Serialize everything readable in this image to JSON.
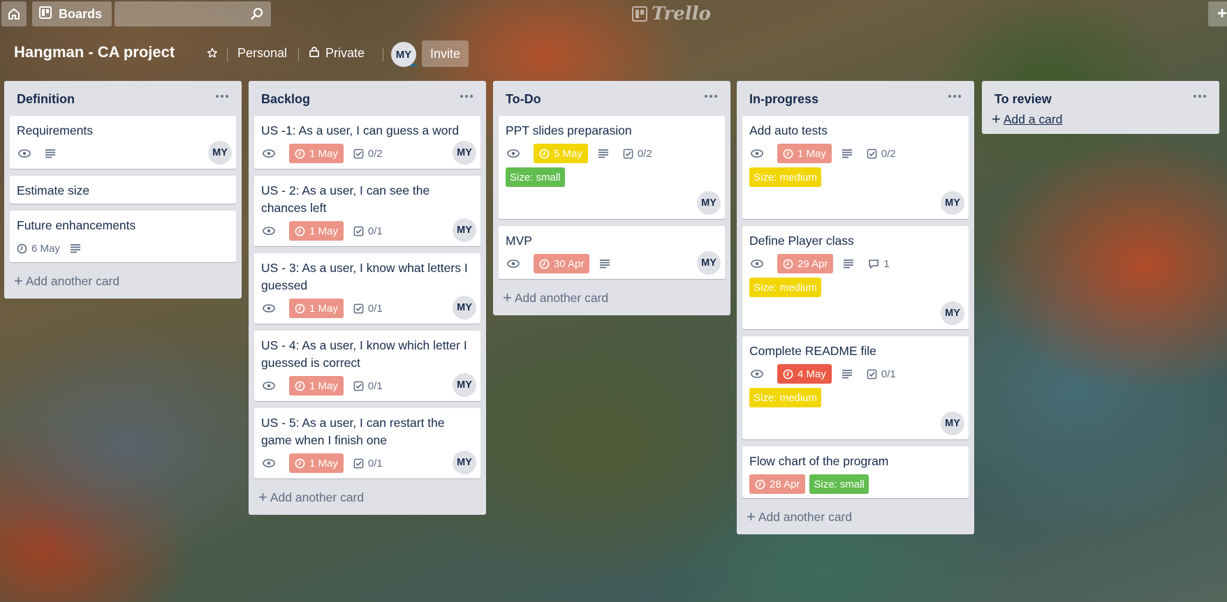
{
  "topbar": {
    "boards_label": "Boards",
    "plus_label": "+",
    "logo_text": "Trello"
  },
  "board": {
    "title": "Hangman - CA project",
    "team": "Personal",
    "visibility": "Private",
    "member_initials": "MY",
    "invite_label": "Invite"
  },
  "lists": [
    {
      "title": "Definition",
      "add_label": "Add another card",
      "cards": [
        {
          "title": "Requirements",
          "member": "MY"
        },
        {
          "title": "Estimate size"
        },
        {
          "title": "Future enhancements",
          "due": "6 May"
        }
      ]
    },
    {
      "title": "Backlog",
      "add_label": "Add another card",
      "cards": [
        {
          "title": "US -1: As a user, I can guess a word",
          "due": "1 May",
          "checklist": "0/2",
          "member": "MY"
        },
        {
          "title": "US - 2: As a user, I can see the chances left",
          "due": "1 May",
          "checklist": "0/1",
          "member": "MY"
        },
        {
          "title": "US - 3: As a user, I know what letters I guessed",
          "due": "1 May",
          "checklist": "0/1",
          "member": "MY"
        },
        {
          "title": "US - 4: As a user, I know which letter I guessed is correct",
          "due": "1 May",
          "checklist": "0/1",
          "member": "MY"
        },
        {
          "title": "US - 5: As a user, I can restart the game when I finish one",
          "due": "1 May",
          "checklist": "0/1",
          "member": "MY"
        }
      ]
    },
    {
      "title": "To-Do",
      "add_label": "Add another card",
      "cards": [
        {
          "title": "PPT slides preparasion",
          "due": "5 May",
          "checklist": "0/2",
          "label": "Size: small",
          "member": "MY"
        },
        {
          "title": "MVP",
          "due": "30 Apr",
          "member": "MY"
        }
      ]
    },
    {
      "title": "In-progress",
      "add_label": "Add another card",
      "cards": [
        {
          "title": "Add auto tests",
          "due": "1 May",
          "checklist": "0/2",
          "label": "Size: medium",
          "member": "MY"
        },
        {
          "title": "Define Player class",
          "due": "29 Apr",
          "comments": "1",
          "label": "Size: medium",
          "member": "MY"
        },
        {
          "title": "Complete README file",
          "due": "4 May",
          "checklist": "0/1",
          "label": "Size: medium",
          "member": "MY"
        },
        {
          "title": "Flow chart of the program",
          "due": "28 Apr",
          "label": "Size: small"
        }
      ]
    },
    {
      "title": "To review",
      "add_label": "Add a card",
      "cards": []
    }
  ],
  "colors": {
    "due_overdue": "#ec9488",
    "due_soon": "#f2d600",
    "due_red": "#eb5a46",
    "label_green": "#61bd4f",
    "label_yellow": "#f2d600"
  }
}
